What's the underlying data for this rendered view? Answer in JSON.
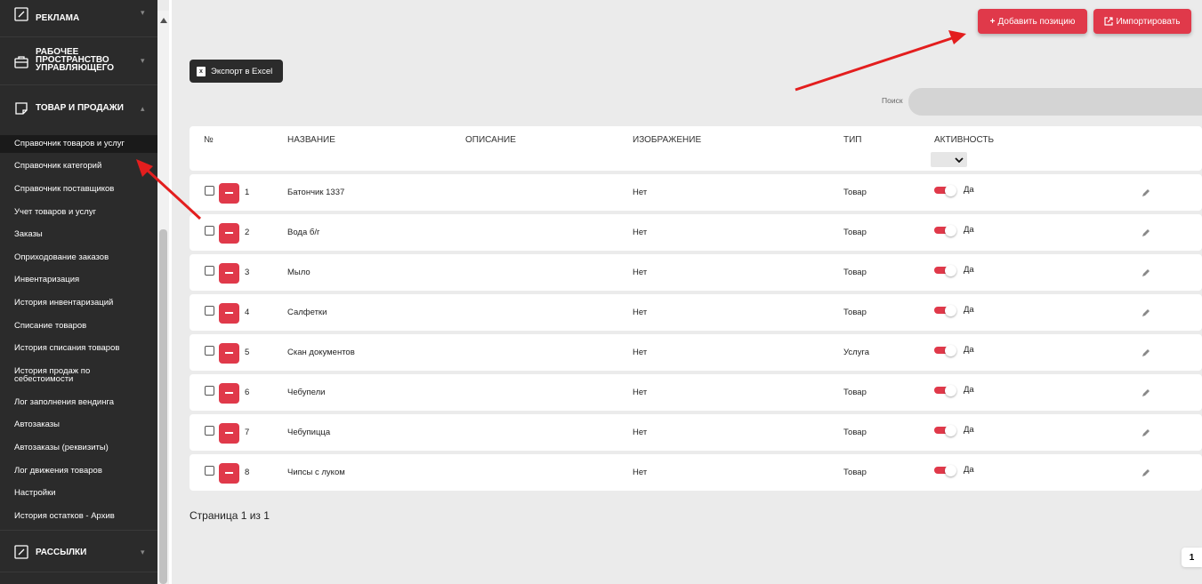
{
  "sidebar": {
    "sections": [
      {
        "label": "РЕКЛАМА",
        "icon": "edit-square-icon"
      },
      {
        "label": "РАБОЧЕЕ ПРОСТРАНСТВО УПРАВЛЯЮЩЕГО",
        "icon": "briefcase-icon"
      },
      {
        "label": "ТОВАР И ПРОДАЖИ",
        "icon": "note-icon"
      },
      {
        "label": "РАССЫЛКИ",
        "icon": "edit-square-icon"
      }
    ],
    "items": [
      "Справочник товаров и услуг",
      "Справочник категорий",
      "Справочник поставщиков",
      "Учет товаров и услуг",
      "Заказы",
      "Оприходование заказов",
      "Инвентаризация",
      "История инвентаризаций",
      "Списание товаров",
      "История списания товаров",
      "История продаж по себестоимости",
      "Лог заполнения вендинга",
      "Автозаказы",
      "Автозаказы (реквизиты)",
      "Лог движения товаров",
      "Настройки",
      "История остатков - Архив"
    ],
    "active_item": "Справочник товаров и услуг"
  },
  "toolbar": {
    "add_label": "Добавить позицию",
    "import_label": "Импортировать",
    "export_label": "Экспорт в Excel",
    "search_label": "Поиск"
  },
  "table": {
    "headers": {
      "num": "№",
      "name": "НАЗВАНИЕ",
      "desc": "ОПИСАНИЕ",
      "image": "ИЗОБРАЖЕНИЕ",
      "type": "ТИП",
      "active": "АКТИВНОСТЬ"
    },
    "rows": [
      {
        "num": "1",
        "name": "Батончик 1337",
        "image": "Нет",
        "type": "Товар",
        "active": "Да"
      },
      {
        "num": "2",
        "name": "Вода б/г",
        "image": "Нет",
        "type": "Товар",
        "active": "Да"
      },
      {
        "num": "3",
        "name": "Мыло",
        "image": "Нет",
        "type": "Товар",
        "active": "Да"
      },
      {
        "num": "4",
        "name": "Салфетки",
        "image": "Нет",
        "type": "Товар",
        "active": "Да"
      },
      {
        "num": "5",
        "name": "Скан документов",
        "image": "Нет",
        "type": "Услуга",
        "active": "Да"
      },
      {
        "num": "6",
        "name": "Чебупели",
        "image": "Нет",
        "type": "Товар",
        "active": "Да"
      },
      {
        "num": "7",
        "name": "Чебупицца",
        "image": "Нет",
        "type": "Товар",
        "active": "Да"
      },
      {
        "num": "8",
        "name": "Чипсы с луком",
        "image": "Нет",
        "type": "Товар",
        "active": "Да"
      }
    ]
  },
  "pagination": {
    "text": "Страница 1 из 1",
    "current": "1"
  },
  "colors": {
    "accent": "#e0394a",
    "sidebar": "#2b2b2b",
    "background": "#ebebeb"
  }
}
